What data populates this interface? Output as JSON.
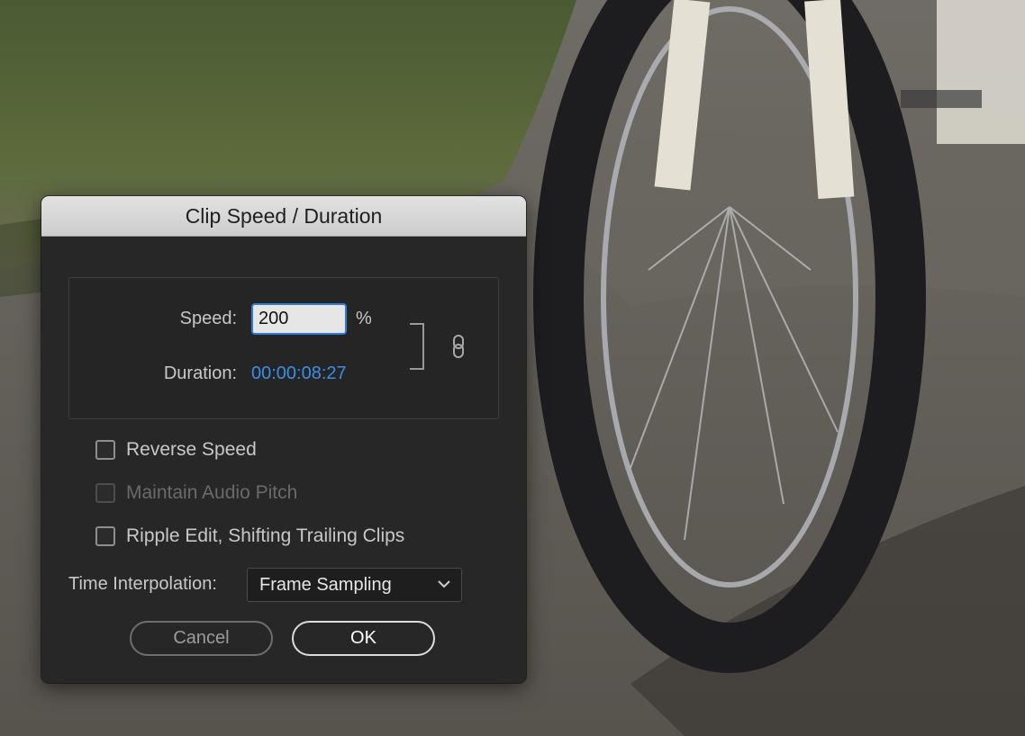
{
  "dialog": {
    "title": "Clip Speed / Duration",
    "speed_label": "Speed:",
    "speed_value": "200",
    "speed_unit": "%",
    "duration_label": "Duration:",
    "duration_value": "00:00:08:27",
    "link_icon": "chain-link-icon",
    "options": [
      {
        "label": "Reverse Speed",
        "checked": false,
        "enabled": true
      },
      {
        "label": "Maintain Audio Pitch",
        "checked": false,
        "enabled": false
      },
      {
        "label": "Ripple Edit, Shifting Trailing Clips",
        "checked": false,
        "enabled": true
      }
    ],
    "interpolation_label": "Time Interpolation:",
    "interpolation_value": "Frame Sampling",
    "cancel_label": "Cancel",
    "ok_label": "OK"
  },
  "colors": {
    "accent": "#3b8ee8",
    "dialog_bg": "#272727"
  }
}
